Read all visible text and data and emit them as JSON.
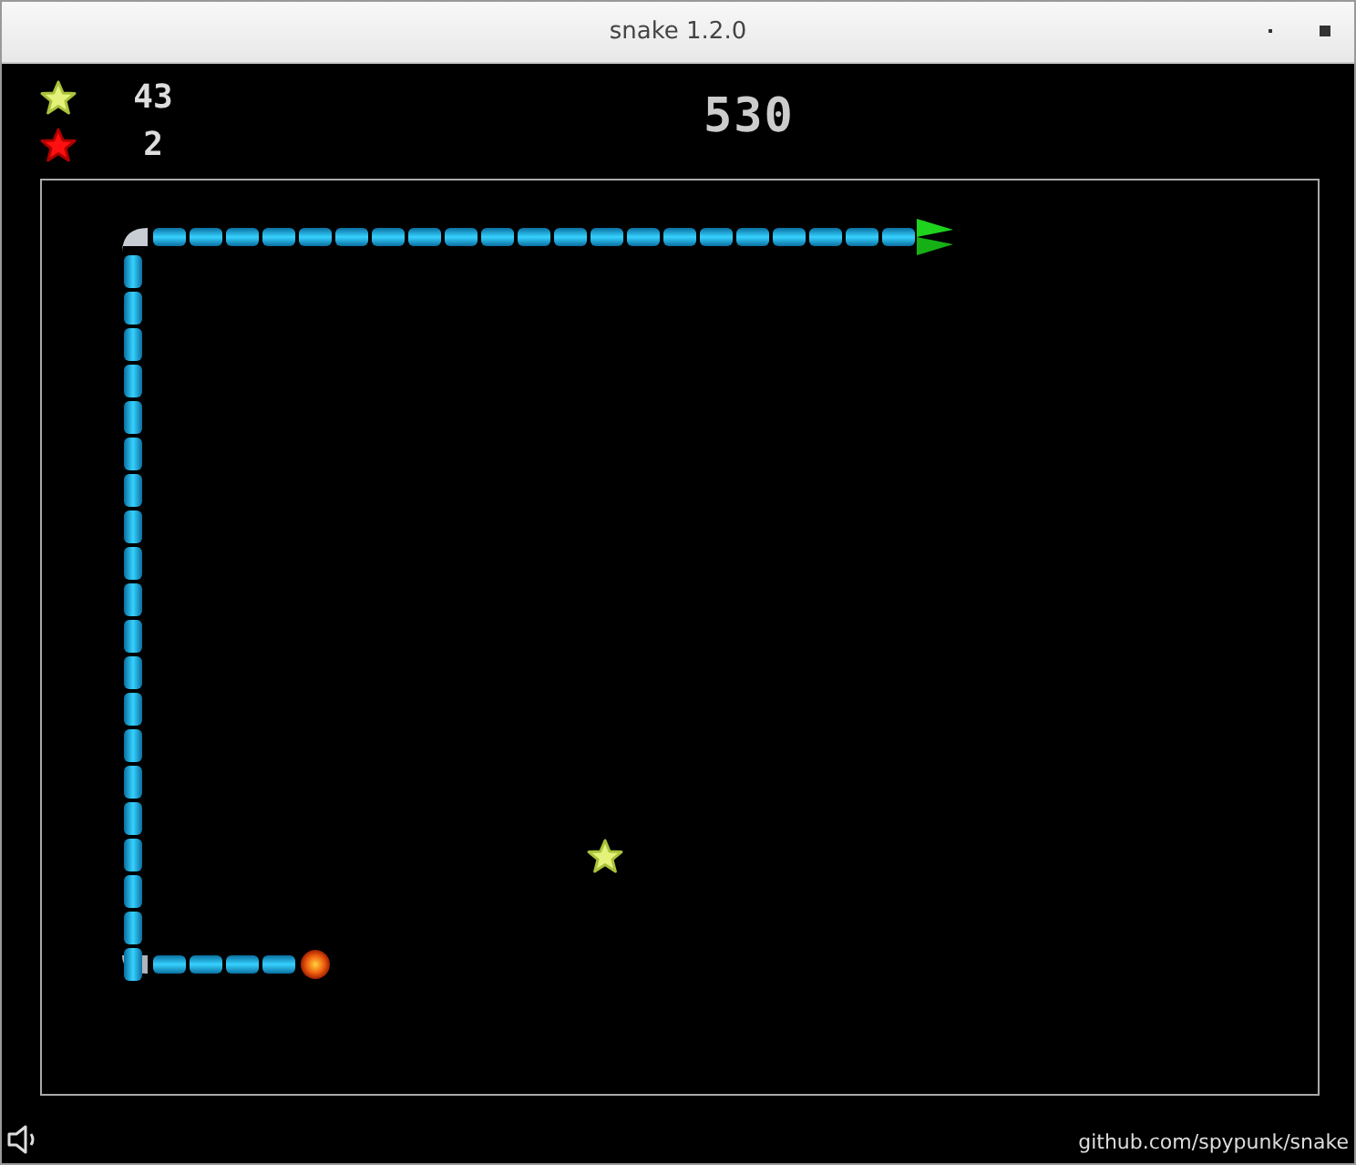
{
  "window": {
    "title": "snake 1.2.0"
  },
  "hud": {
    "bonus_count": "43",
    "penalty_count": "2",
    "score": "530"
  },
  "footer": {
    "link": "github.com/spypunk/snake"
  }
}
